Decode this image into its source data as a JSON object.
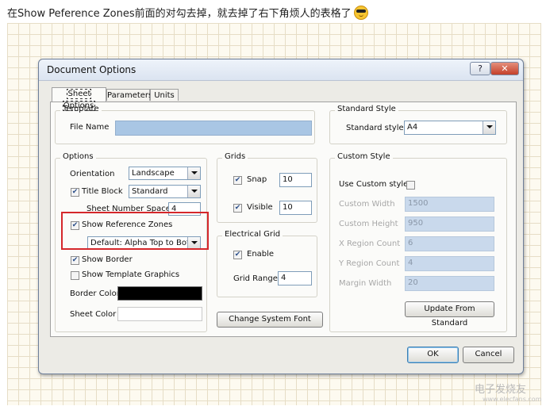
{
  "caption": "在Show Peference Zones前面的对勾去掉，就去掉了右下角烦人的表格了",
  "dialog": {
    "title": "Document Options",
    "help_glyph": "?",
    "close_glyph": "✕",
    "tabs": [
      "Sheet Options",
      "Parameters",
      "Units"
    ],
    "active_tab": "Sheet Options",
    "template": {
      "group_title": "Template",
      "file_name_label": "File Name",
      "file_name_value": ""
    },
    "standard_style": {
      "group_title": "Standard Style",
      "label": "Standard styles",
      "value": "A4"
    },
    "options": {
      "group_title": "Options",
      "orientation_label": "Orientation",
      "orientation_value": "Landscape",
      "title_block_label": "Title Block",
      "title_block_checked": true,
      "title_block_value": "Standard",
      "sheet_number_spaces_label": "Sheet Number Spaces",
      "sheet_number_spaces_value": "4",
      "show_reference_zones_label": "Show Reference Zones",
      "show_reference_zones_checked": true,
      "reference_zone_style": "Default: Alpha Top to Bottom,",
      "show_border_label": "Show Border",
      "show_border_checked": true,
      "show_template_graphics_label": "Show Template Graphics",
      "show_template_graphics_checked": false,
      "border_color_label": "Border Color",
      "border_color": "#000000",
      "sheet_color_label": "Sheet Color",
      "sheet_color": "#ffffff"
    },
    "grids": {
      "group_title": "Grids",
      "snap_label": "Snap",
      "snap_checked": true,
      "snap_value": "10",
      "visible_label": "Visible",
      "visible_checked": true,
      "visible_value": "10"
    },
    "electrical_grid": {
      "group_title": "Electrical Grid",
      "enable_label": "Enable",
      "enable_checked": true,
      "grid_range_label": "Grid Range",
      "grid_range_value": "4"
    },
    "change_system_font_button": "Change System Font",
    "custom_style": {
      "group_title": "Custom Style",
      "use_custom_label": "Use Custom style",
      "use_custom_checked": false,
      "rows": [
        {
          "label": "Custom Width",
          "value": "1500"
        },
        {
          "label": "Custom Height",
          "value": "950"
        },
        {
          "label": "X Region Count",
          "value": "6"
        },
        {
          "label": "Y Region Count",
          "value": "4"
        },
        {
          "label": "Margin Width",
          "value": "20"
        }
      ],
      "update_button": "Update From Standard"
    },
    "ok_button": "OK",
    "cancel_button": "Cancel"
  },
  "watermark": "电子发烧友",
  "watermark_url": "www.elecfans.com",
  "colors": {
    "highlight": "#d5272b",
    "field_blue": "#a9c6e4",
    "accent": "#3c7fb1"
  }
}
